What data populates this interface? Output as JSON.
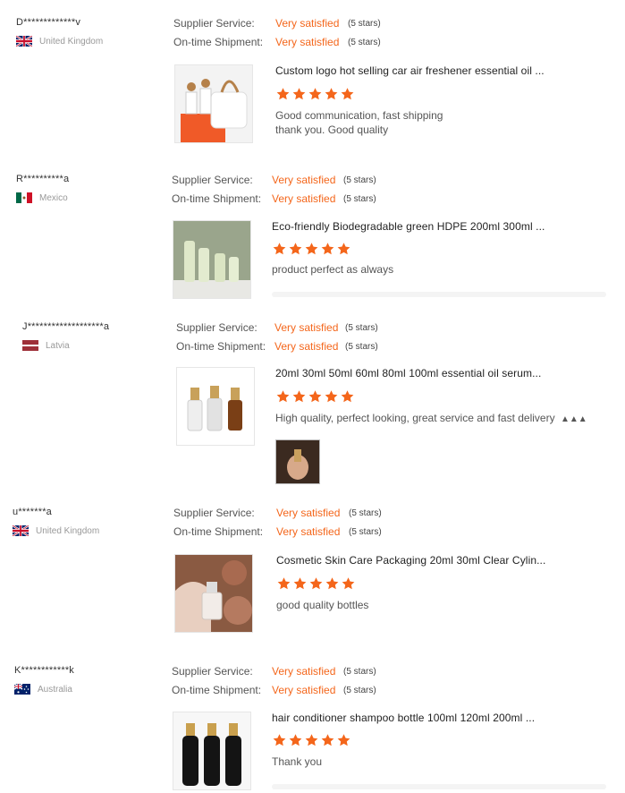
{
  "colors": {
    "accent": "#f4661b",
    "star": "#f4661b"
  },
  "labels": {
    "supplier_service": "Supplier Service:",
    "on_time_shipment": "On-time Shipment:"
  },
  "reviews": [
    {
      "buyer": "D*************v",
      "country": "United Kingdom",
      "flag_icon": "uk-flag-icon",
      "supplier_value": "Very satisfied",
      "supplier_stars": "(5 stars)",
      "shipment_value": "Very satisfied",
      "shipment_stars": "(5 stars)",
      "product_title": "Custom logo hot selling car air freshener essential oil ...",
      "rating": 5,
      "comment": [
        "Good communication, fast shipping",
        "thank you. Good quality"
      ]
    },
    {
      "buyer": "R**********a",
      "country": "Mexico",
      "flag_icon": "mexico-flag-icon",
      "supplier_value": "Very satisfied",
      "supplier_stars": "(5 stars)",
      "shipment_value": "Very satisfied",
      "shipment_stars": "(5 stars)",
      "product_title": "Eco-friendly Biodegradable green HDPE 200ml 300ml ...",
      "rating": 5,
      "comment": [
        "product perfect as always"
      ]
    },
    {
      "buyer": "J*******************a",
      "country": "Latvia",
      "flag_icon": "latvia-flag-icon",
      "supplier_value": "Very satisfied",
      "supplier_stars": "(5 stars)",
      "shipment_value": "Very satisfied",
      "shipment_stars": "(5 stars)",
      "product_title": "20ml 30ml 50ml 60ml 80ml 100ml essential oil serum...",
      "rating": 5,
      "comment": [
        "High quality, perfect looking, great service and fast delivery"
      ]
    },
    {
      "buyer": "u*******a",
      "country": "United Kingdom",
      "flag_icon": "uk-flag-icon",
      "supplier_value": "Very satisfied",
      "supplier_stars": "(5 stars)",
      "shipment_value": "Very satisfied",
      "shipment_stars": "(5 stars)",
      "product_title": "Cosmetic Skin Care Packaging 20ml 30ml Clear Cylin...",
      "rating": 5,
      "comment": [
        "good quality bottles"
      ]
    },
    {
      "buyer": "K************k",
      "country": "Australia",
      "flag_icon": "australia-flag-icon",
      "supplier_value": "Very satisfied",
      "supplier_stars": "(5 stars)",
      "shipment_value": "Very satisfied",
      "shipment_stars": "(5 stars)",
      "product_title": "hair conditioner shampoo bottle 100ml 120ml 200ml ...",
      "rating": 5,
      "comment": [
        "Thank you"
      ]
    }
  ]
}
